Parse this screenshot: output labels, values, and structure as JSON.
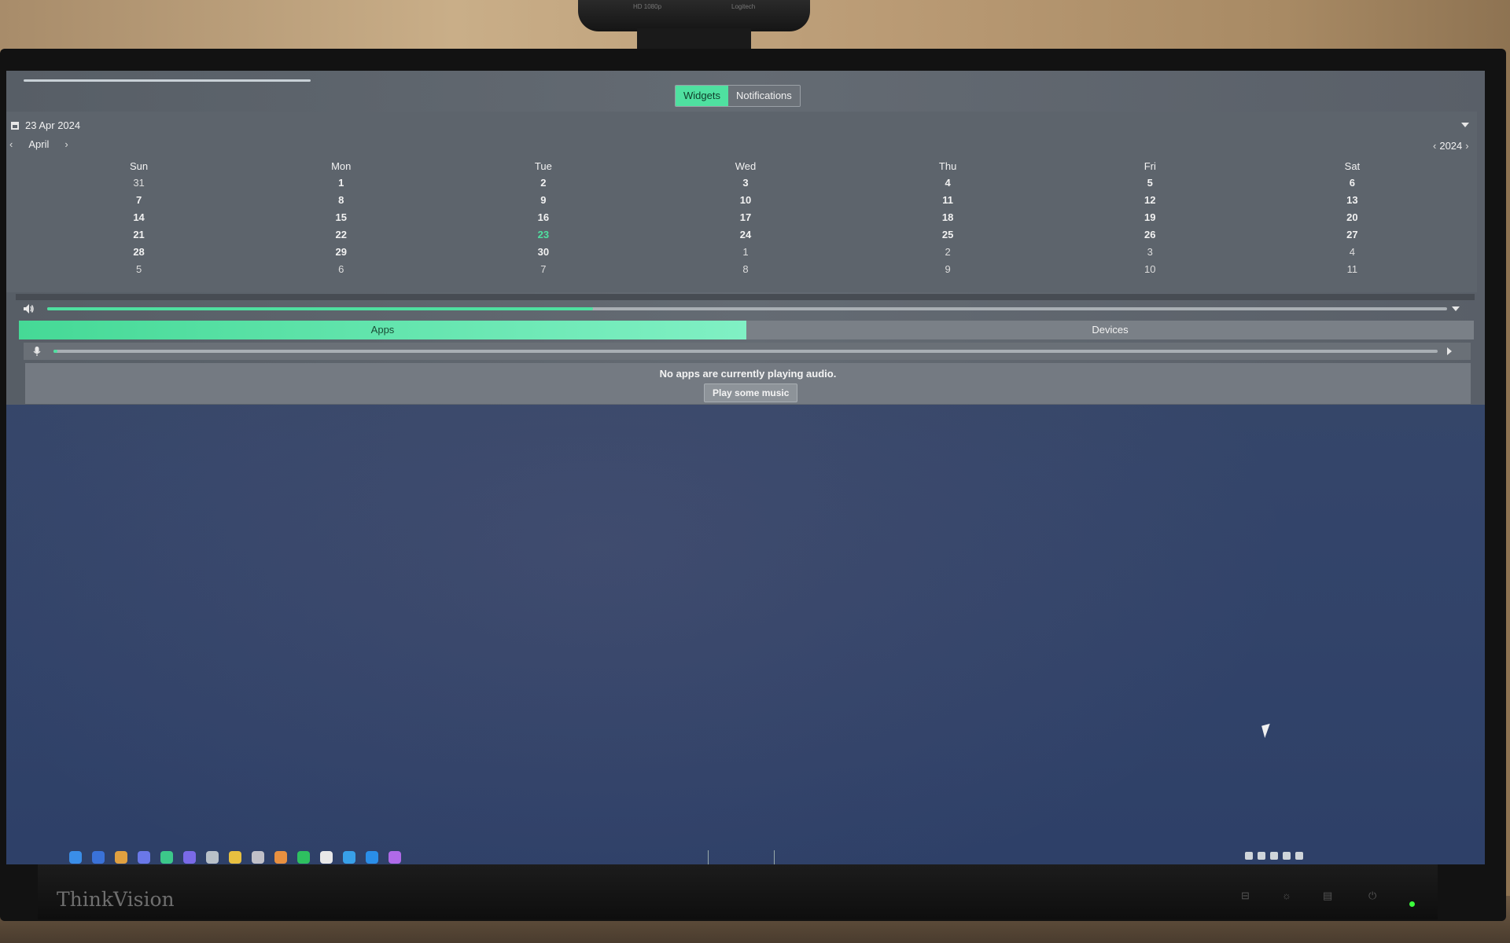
{
  "webcam": {
    "label_left": "HD 1080p",
    "label_right": "Logitech"
  },
  "monitor": {
    "brand": "ThinkVision"
  },
  "panel": {
    "tabs": [
      {
        "label": "Widgets",
        "active": true
      },
      {
        "label": "Notifications",
        "active": false
      }
    ],
    "calendar": {
      "date_header": "23 Apr 2024",
      "month": "April",
      "year": "2024",
      "weekdays": [
        "Sun",
        "Mon",
        "Tue",
        "Wed",
        "Thu",
        "Fri",
        "Sat"
      ],
      "today": "23",
      "weeks": [
        [
          "31",
          "1",
          "2",
          "3",
          "4",
          "5",
          "6"
        ],
        [
          "7",
          "8",
          "9",
          "10",
          "11",
          "12",
          "13"
        ],
        [
          "14",
          "15",
          "16",
          "17",
          "18",
          "19",
          "20"
        ],
        [
          "21",
          "22",
          "23",
          "24",
          "25",
          "26",
          "27"
        ],
        [
          "28",
          "29",
          "30",
          "1",
          "2",
          "3",
          "4"
        ],
        [
          "5",
          "6",
          "7",
          "8",
          "9",
          "10",
          "11"
        ]
      ],
      "other_month_flags": [
        [
          true,
          false,
          false,
          false,
          false,
          false,
          false
        ],
        [
          false,
          false,
          false,
          false,
          false,
          false,
          false
        ],
        [
          false,
          false,
          false,
          false,
          false,
          false,
          false
        ],
        [
          false,
          false,
          false,
          false,
          false,
          false,
          false
        ],
        [
          false,
          false,
          false,
          true,
          true,
          true,
          true
        ],
        [
          true,
          true,
          true,
          true,
          true,
          true,
          true
        ]
      ]
    },
    "audio": {
      "output_volume_fraction": 0.39,
      "mic_volume_fraction": 0.003,
      "segments": [
        {
          "label": "Apps",
          "active": true
        },
        {
          "label": "Devices",
          "active": false
        }
      ],
      "empty_message": "No apps are currently playing audio.",
      "play_button": "Play some music"
    }
  },
  "colors": {
    "accent": "#4fe0a0",
    "panel_bg": "#5d646c",
    "desktop_bg": "#34456a"
  },
  "taskbar": {
    "icons": [
      "start-icon",
      "check-icon",
      "browser-icon",
      "chat-icon",
      "app-icon",
      "discord-icon",
      "mail-icon",
      "chrome-icon",
      "settings-icon",
      "firefox-icon",
      "spotify-icon",
      "tool-icon",
      "telegram-icon",
      "code-icon",
      "media-icon"
    ]
  }
}
